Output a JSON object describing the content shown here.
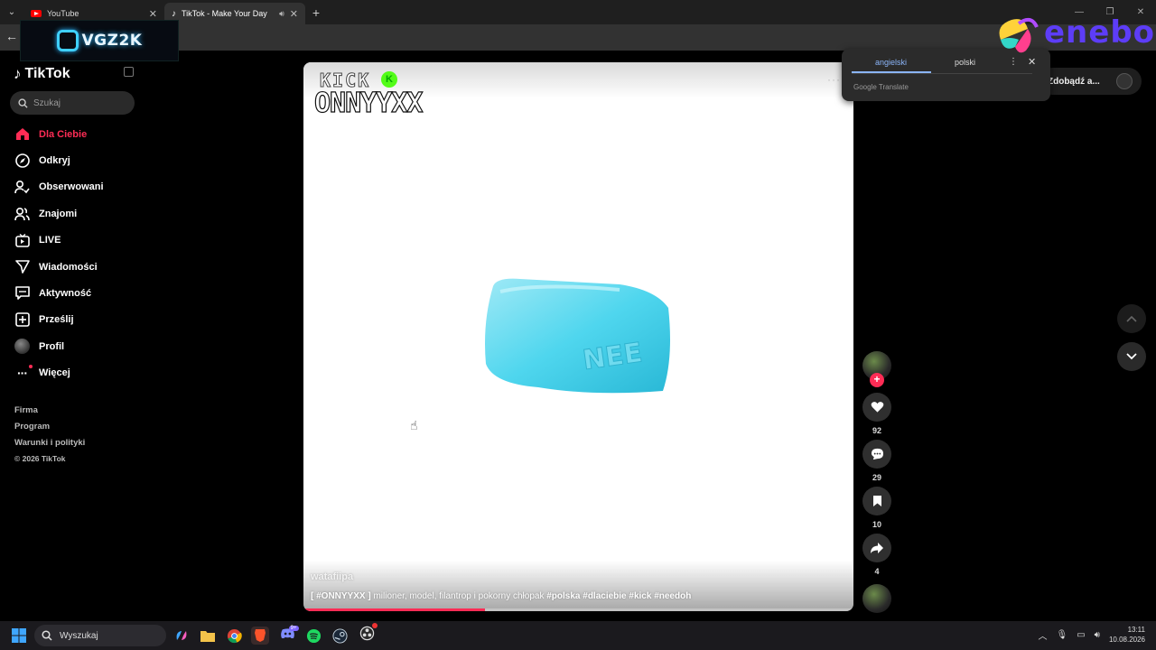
{
  "browser": {
    "tabs": [
      {
        "label": "YouTube",
        "icon": "youtube-icon",
        "active": false
      },
      {
        "label": "TikTok - Make Your Day",
        "icon": "tiktok-icon",
        "active": true
      }
    ],
    "overlay_logo": "VGZ2K",
    "ad_logo": "enebo"
  },
  "translate_popup": {
    "tab_source": "angielski",
    "tab_target": "polski",
    "brand": "Google Translate"
  },
  "sidebar": {
    "brand": "TikTok",
    "search_placeholder": "Szukaj",
    "items": [
      {
        "label": "Dla Ciebie",
        "icon": "home-icon",
        "active": true
      },
      {
        "label": "Odkryj",
        "icon": "compass-icon"
      },
      {
        "label": "Obserwowani",
        "icon": "following-icon"
      },
      {
        "label": "Znajomi",
        "icon": "friends-icon"
      },
      {
        "label": "LIVE",
        "icon": "live-icon"
      },
      {
        "label": "Wiadomości",
        "icon": "messages-icon"
      },
      {
        "label": "Aktywność",
        "icon": "activity-icon"
      },
      {
        "label": "Prześlij",
        "icon": "upload-icon"
      },
      {
        "label": "Profil",
        "icon": "profile-icon"
      },
      {
        "label": "Więcej",
        "icon": "more-icon"
      }
    ],
    "footer": [
      "Firma",
      "Program",
      "Warunki i polityki"
    ],
    "copyright": "© 2026 TikTok"
  },
  "header": {
    "get_app": "Zdobądź a..."
  },
  "video": {
    "overlay_platform": "KICK",
    "overlay_channel": "ONNYYXX",
    "author": "watafiipa",
    "caption_tag": "[ #ONNYYXX ]",
    "caption_text": " milioner, model, filantrop i pokorny chłopak ",
    "caption_hashtags": "#polska #dlaciebie #kick #needoh",
    "progress": 0.33,
    "colors": {
      "accent": "#fe2c55",
      "soap": "#4fd6ee"
    }
  },
  "actions": {
    "likes": "92",
    "comments": "29",
    "saves": "10",
    "shares": "4"
  },
  "taskbar": {
    "search_placeholder": "Wyszukaj",
    "time": "13:11",
    "date": "10.08.2026",
    "discord_badge": "9+"
  }
}
